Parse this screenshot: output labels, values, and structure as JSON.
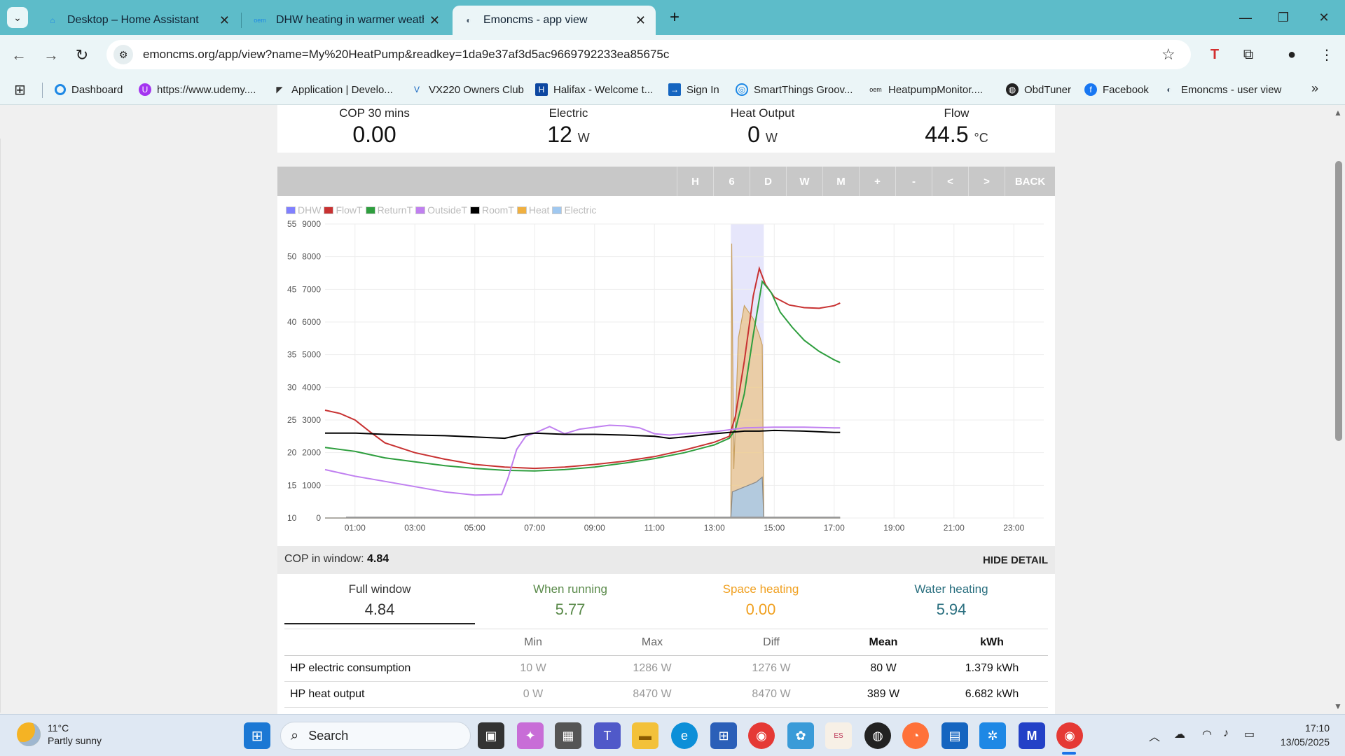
{
  "browser": {
    "tabs": [
      {
        "title": "Desktop – Home Assistant",
        "icon": "home-assistant-icon"
      },
      {
        "title": "DHW heating in warmer weathe",
        "icon": "openenergymonitor-icon"
      },
      {
        "title": "Emoncms - app view",
        "icon": "emoncms-icon",
        "active": true
      }
    ],
    "url": "emoncms.org/app/view?name=My%20HeatPump&readkey=1da9e37af3d5ac9669792233ea85675c",
    "bookmarks": [
      "Dashboard",
      "https://www.udemy....",
      "Application | Develo...",
      "VX220 Owners Club",
      "Halifax - Welcome t...",
      "Sign In",
      "SmartThings Groov...",
      "HeatpumpMonitor....",
      "ObdTuner",
      "Facebook",
      "Emoncms - user view"
    ]
  },
  "stats": [
    {
      "label": "COP 30 mins",
      "value": "0.00",
      "unit": ""
    },
    {
      "label": "Electric",
      "value": "12",
      "unit": "W"
    },
    {
      "label": "Heat Output",
      "value": "0",
      "unit": "W"
    },
    {
      "label": "Flow",
      "value": "44.5",
      "unit": "°C"
    }
  ],
  "range_buttons": [
    "H",
    "6",
    "D",
    "W",
    "M",
    "+",
    "-",
    "<",
    ">",
    "BACK"
  ],
  "chart_data": {
    "type": "line",
    "legend": [
      "DHW",
      "FlowT",
      "ReturnT",
      "OutsideT",
      "RoomT",
      "Heat",
      "Electric"
    ],
    "legend_colors": [
      "#8080ff",
      "#c83232",
      "#2e9e3e",
      "#c080f0",
      "#000000",
      "#f0b040",
      "#a0c8f0"
    ],
    "x_ticks": [
      "01:00",
      "03:00",
      "05:00",
      "07:00",
      "09:00",
      "11:00",
      "13:00",
      "15:00",
      "17:00",
      "19:00",
      "21:00",
      "23:00"
    ],
    "x_range_hours": [
      0,
      24
    ],
    "y_left_ticks": [
      "55",
      "50",
      "45",
      "40",
      "35",
      "30",
      "25",
      "20",
      "15",
      "10"
    ],
    "y_left_range": [
      10,
      55
    ],
    "y_right_ticks": [
      "9000",
      "8000",
      "7000",
      "6000",
      "5000",
      "4000",
      "3000",
      "2000",
      "1000",
      "0"
    ],
    "y_right_range": [
      0,
      9000
    ],
    "dhw_window_hours": [
      13.55,
      14.65
    ],
    "series": [
      {
        "name": "FlowT",
        "axis": "left",
        "color": "#c83232",
        "points": [
          [
            0,
            26.5
          ],
          [
            0.5,
            26.0
          ],
          [
            1,
            25.0
          ],
          [
            1.5,
            23.2
          ],
          [
            2,
            21.5
          ],
          [
            3,
            20.0
          ],
          [
            4,
            19.0
          ],
          [
            5,
            18.2
          ],
          [
            6,
            17.8
          ],
          [
            7,
            17.6
          ],
          [
            8,
            17.8
          ],
          [
            9,
            18.2
          ],
          [
            10,
            18.7
          ],
          [
            11,
            19.4
          ],
          [
            12,
            20.4
          ],
          [
            13,
            21.6
          ],
          [
            13.5,
            22.5
          ],
          [
            13.7,
            25.5
          ],
          [
            14,
            34
          ],
          [
            14.3,
            44
          ],
          [
            14.5,
            48.2
          ],
          [
            14.7,
            45.8
          ],
          [
            15,
            43.8
          ],
          [
            15.5,
            42.6
          ],
          [
            16,
            42.2
          ],
          [
            16.5,
            42.1
          ],
          [
            17,
            42.5
          ],
          [
            17.2,
            42.9
          ]
        ]
      },
      {
        "name": "ReturnT",
        "axis": "left",
        "color": "#2e9e3e",
        "points": [
          [
            0,
            20.8
          ],
          [
            1,
            20.2
          ],
          [
            2,
            19.2
          ],
          [
            3,
            18.6
          ],
          [
            4,
            18.0
          ],
          [
            5,
            17.6
          ],
          [
            6,
            17.3
          ],
          [
            7,
            17.2
          ],
          [
            8,
            17.4
          ],
          [
            9,
            17.8
          ],
          [
            10,
            18.4
          ],
          [
            11,
            19.1
          ],
          [
            12,
            20.0
          ],
          [
            13,
            21.2
          ],
          [
            13.5,
            22.2
          ],
          [
            13.7,
            23.5
          ],
          [
            14,
            29
          ],
          [
            14.3,
            38
          ],
          [
            14.6,
            46.2
          ],
          [
            14.9,
            44.5
          ],
          [
            15.2,
            41.5
          ],
          [
            15.6,
            39.2
          ],
          [
            16,
            37.2
          ],
          [
            16.5,
            35.5
          ],
          [
            17,
            34.2
          ],
          [
            17.2,
            33.8
          ]
        ]
      },
      {
        "name": "OutsideT",
        "axis": "left",
        "color": "#c080f0",
        "points": [
          [
            0,
            17.4
          ],
          [
            0.5,
            16.9
          ],
          [
            1,
            16.4
          ],
          [
            2,
            15.6
          ],
          [
            3,
            14.8
          ],
          [
            4,
            14.0
          ],
          [
            5,
            13.5
          ],
          [
            5.9,
            13.6
          ],
          [
            6.1,
            16
          ],
          [
            6.4,
            20.5
          ],
          [
            6.7,
            22.5
          ],
          [
            7,
            23.0
          ],
          [
            7.5,
            24.0
          ],
          [
            8,
            22.9
          ],
          [
            8.5,
            23.6
          ],
          [
            9,
            23.9
          ],
          [
            9.5,
            24.2
          ],
          [
            10,
            24.1
          ],
          [
            10.5,
            23.8
          ],
          [
            11,
            22.9
          ],
          [
            11.5,
            22.7
          ],
          [
            12,
            22.9
          ],
          [
            13,
            23.2
          ],
          [
            13.5,
            23.5
          ],
          [
            14,
            23.8
          ],
          [
            15,
            23.9
          ],
          [
            16,
            23.9
          ],
          [
            17,
            23.8
          ],
          [
            17.2,
            23.8
          ]
        ]
      },
      {
        "name": "RoomT",
        "axis": "left",
        "color": "#000000",
        "points": [
          [
            0,
            23.0
          ],
          [
            1,
            23.0
          ],
          [
            2,
            22.8
          ],
          [
            3,
            22.7
          ],
          [
            4,
            22.6
          ],
          [
            5,
            22.4
          ],
          [
            6,
            22.2
          ],
          [
            6.5,
            22.7
          ],
          [
            7,
            23.0
          ],
          [
            8,
            22.8
          ],
          [
            9,
            22.8
          ],
          [
            10,
            22.7
          ],
          [
            11,
            22.5
          ],
          [
            11.5,
            22.2
          ],
          [
            12,
            22.4
          ],
          [
            13,
            22.9
          ],
          [
            13.5,
            23.1
          ],
          [
            14,
            23.3
          ],
          [
            14.5,
            23.3
          ],
          [
            15,
            23.4
          ],
          [
            16,
            23.3
          ],
          [
            17,
            23.1
          ],
          [
            17.2,
            23.1
          ]
        ]
      },
      {
        "name": "Heat",
        "axis": "right",
        "color": "#f0b040",
        "fill": true,
        "points": [
          [
            0,
            0
          ],
          [
            13.55,
            0
          ],
          [
            13.58,
            8400
          ],
          [
            13.65,
            1500
          ],
          [
            13.8,
            5500
          ],
          [
            14,
            6500
          ],
          [
            14.3,
            6100
          ],
          [
            14.5,
            5600
          ],
          [
            14.6,
            5300
          ],
          [
            14.65,
            0
          ],
          [
            17.2,
            0
          ]
        ]
      },
      {
        "name": "Electric",
        "axis": "right",
        "color": "#a0c8f0",
        "fill": true,
        "points": [
          [
            0,
            0
          ],
          [
            13.55,
            0
          ],
          [
            13.6,
            800
          ],
          [
            14,
            950
          ],
          [
            14.4,
            1100
          ],
          [
            14.6,
            1250
          ],
          [
            14.65,
            0
          ],
          [
            17.2,
            0
          ]
        ]
      }
    ]
  },
  "cop_bar": {
    "label": "COP in window:",
    "value": "4.84",
    "hide_label": "HIDE DETAIL"
  },
  "modes": [
    {
      "label": "Full window",
      "value": "4.84",
      "color": "#333333"
    },
    {
      "label": "When running",
      "value": "5.77",
      "color": "#5a8a4a"
    },
    {
      "label": "Space heating",
      "value": "0.00",
      "color": "#f0a020"
    },
    {
      "label": "Water heating",
      "value": "5.94",
      "color": "#2a6f7f"
    }
  ],
  "table": {
    "headers": [
      "",
      "Min",
      "Max",
      "Diff",
      "Mean",
      "kWh"
    ],
    "rows": [
      {
        "name": "HP electric consumption",
        "min": "10 W",
        "max": "1286 W",
        "diff": "1276 W",
        "mean": "80 W",
        "kwh": "1.379 kWh"
      },
      {
        "name": "HP heat output",
        "min": "0 W",
        "max": "8470 W",
        "diff": "8470 W",
        "mean": "389 W",
        "kwh": "6.682 kWh"
      }
    ]
  },
  "taskbar": {
    "weather_temp": "11°C",
    "weather_text": "Partly sunny",
    "search_label": "Search",
    "time": "17:10",
    "date": "13/05/2025"
  }
}
